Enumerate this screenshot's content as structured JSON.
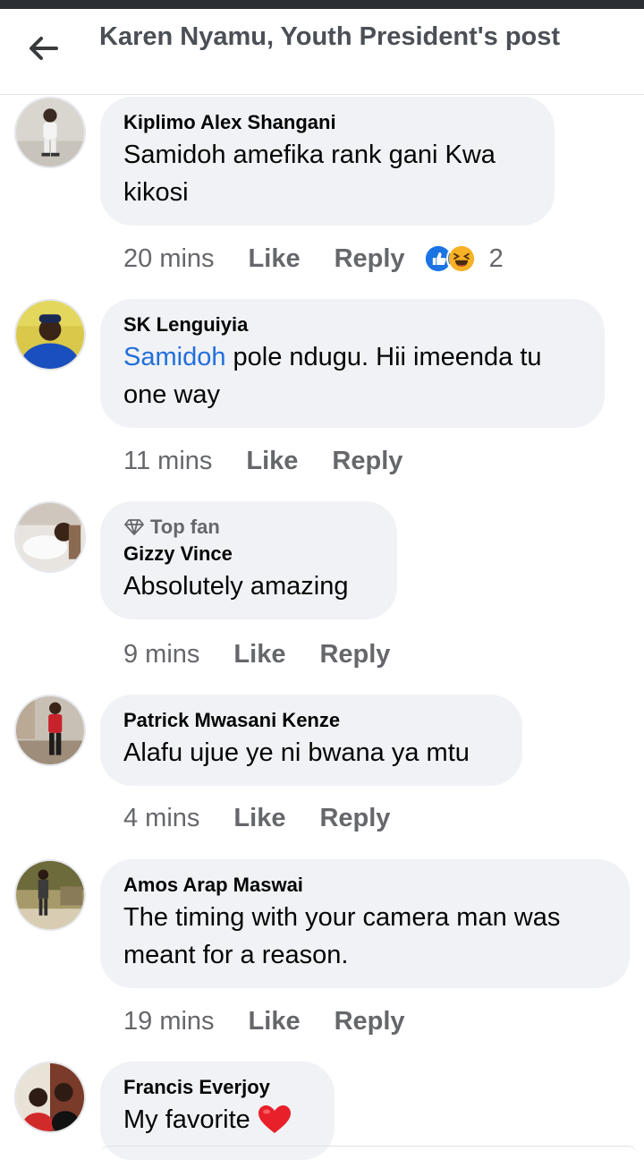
{
  "header": {
    "title": "Karen Nyamu, Youth President's post"
  },
  "actions": {
    "like": "Like",
    "reply": "Reply"
  },
  "comments": [
    {
      "author": "Kiplimo Alex Shangani",
      "text": "Samidoh amefika rank gani Kwa kikosi",
      "time": "20 mins",
      "reaction_count": "2",
      "reactions": [
        "like",
        "haha"
      ]
    },
    {
      "author": "SK Lenguiyia",
      "mention": "Samidoh",
      "text": " pole ndugu. Hii imeenda tu one way",
      "time": "11 mins"
    },
    {
      "badge": "Top fan",
      "author": "Gizzy Vince",
      "text": "Absolutely amazing",
      "time": "9 mins"
    },
    {
      "author": "Patrick Mwasani Kenze",
      "text": "Alafu ujue ye ni bwana ya mtu",
      "time": "4 mins"
    },
    {
      "author": "Amos Arap Maswai",
      "text": "The timing with your camera man was meant for a reason.",
      "time": "19 mins"
    },
    {
      "author": "Francis Everjoy",
      "text": "My favorite",
      "emoji": "heart"
    }
  ],
  "colors": {
    "mention": "#216fdb",
    "bubble": "#f0f2f5",
    "meta": "#65676b"
  }
}
